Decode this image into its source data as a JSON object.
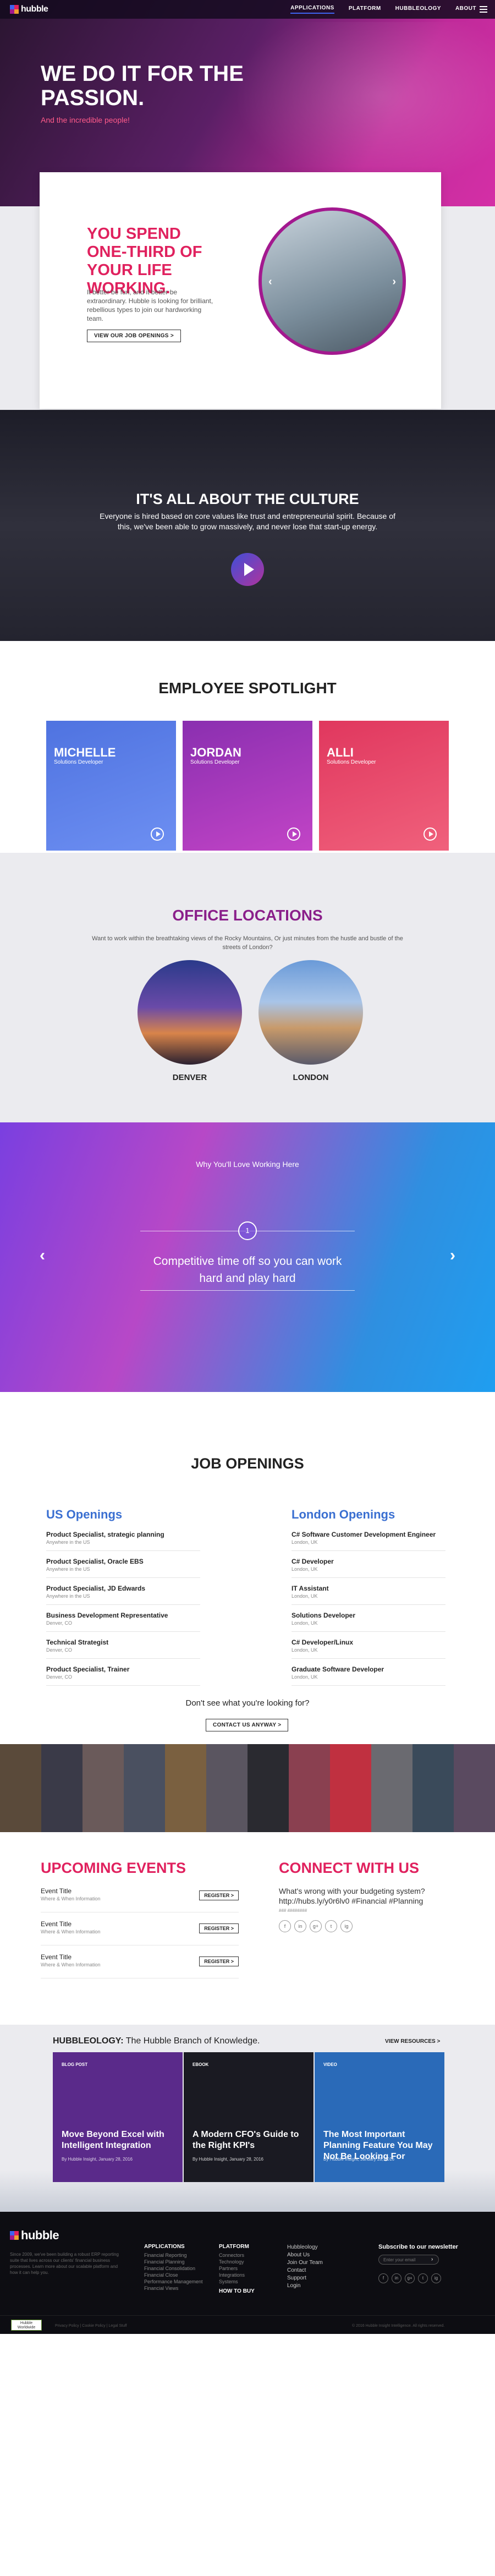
{
  "nav": {
    "logo": "hubble",
    "links": [
      "APPLICATIONS",
      "PLATFORM",
      "HUBBLEOLOGY",
      "ABOUT"
    ]
  },
  "hero": {
    "headline": "WE DO IT FOR THE PASSION.",
    "subline": "And the incredible people!"
  },
  "intro": {
    "headline": "YOU SPEND ONE-THIRD OF YOUR LIFE WORKING.",
    "body": "It better be fun, and it better be extraordinary. Hubble is looking for brilliant, rebellious types to join our hardworking team.",
    "button": "VIEW OUR JOB OPENINGS  >"
  },
  "culture": {
    "title": "IT'S ALL ABOUT THE CULTURE",
    "body": "Everyone is hired based on core values like trust and entrepreneurial spirit. Because of this, we've been able to grow massively, and never lose that start-up energy."
  },
  "spotlight": {
    "title": "EMPLOYEE SPOTLIGHT",
    "cards": [
      {
        "name": "MICHELLE",
        "role": "Solutions Developer",
        "color_top": "#4f73e0",
        "color_bottom": "#6d8ff2"
      },
      {
        "name": "JORDAN",
        "role": "Solutions Developer",
        "color_top": "#8a2fb0",
        "color_bottom": "#c244c6"
      },
      {
        "name": "ALLI",
        "role": "Solutions Developer",
        "color_top": "#e0375e",
        "color_bottom": "#f0617c"
      }
    ]
  },
  "offices": {
    "title": "OFFICE LOCATIONS",
    "body": "Want to work within the breathtaking views of the Rocky Mountains, Or just minutes from the hustle and bustle of the streets of London?",
    "locations": [
      "DENVER",
      "LONDON"
    ]
  },
  "why": {
    "heading": "Why You'll Love Working Here",
    "index": "1",
    "quote": "Competitive time off so you can work hard and play hard"
  },
  "jobs": {
    "title": "JOB OPENINGS",
    "us": {
      "heading": "US Openings",
      "items": [
        {
          "title": "Product Specialist, strategic planning",
          "loc": "Anywhere in the US"
        },
        {
          "title": "Product Specialist, Oracle EBS",
          "loc": "Anywhere in the US"
        },
        {
          "title": "Product Specialist, JD Edwards",
          "loc": "Anywhere in the US"
        },
        {
          "title": "Business Development Representative",
          "loc": "Denver, CO"
        },
        {
          "title": "Technical Strategist",
          "loc": "Denver, CO"
        },
        {
          "title": "Product Specialist, Trainer",
          "loc": "Denver, CO"
        }
      ]
    },
    "london": {
      "heading": "London Openings",
      "items": [
        {
          "title": "C# Software Customer Development Engineer",
          "loc": "London, UK"
        },
        {
          "title": "C# Developer",
          "loc": "London, UK"
        },
        {
          "title": "IT Assistant",
          "loc": "London, UK"
        },
        {
          "title": "Solutions Developer",
          "loc": "London, UK"
        },
        {
          "title": "C# Developer/Linux",
          "loc": "London, UK"
        },
        {
          "title": "Graduate Software Developer",
          "loc": "London, UK"
        }
      ]
    },
    "question": "Don't see what you're looking for?",
    "button": "CONTACT US ANYWAY  >"
  },
  "strip": {
    "colors": [
      "#5a4a3a",
      "#3a3a48",
      "#6a5a5a",
      "#4a5060",
      "#7a6040",
      "#5a5560",
      "#2a2a30",
      "#8a4050",
      "#c03040",
      "#6a6a70",
      "#3a4a5a",
      "#5a4a60"
    ]
  },
  "events": {
    "title": "UPCOMING EVENTS",
    "items": [
      {
        "title": "Event Title",
        "sub": "Where & When Information",
        "button": "REGISTER  >"
      },
      {
        "title": "Event Title",
        "sub": "Where & When Information",
        "button": "REGISTER  >"
      },
      {
        "title": "Event Title",
        "sub": "Where & When Information",
        "button": "REGISTER  >"
      }
    ]
  },
  "connect": {
    "title": "CONNECT WITH US",
    "tweet": "What's wrong with your budgeting system? http://hubs.ly/y0r6lv0 #Financial #Planning",
    "date": "### ########",
    "icons": [
      "f",
      "in",
      "g+",
      "t",
      "ig"
    ]
  },
  "resources": {
    "heading_bold": "HUBBLEOLOGY:",
    "heading_rest": " The Hubble Branch of Knowledge.",
    "view": "VIEW RESOURCES  >",
    "cards": [
      {
        "tag": "BLOG POST",
        "title": "Move Beyond Excel with Intelligent Integration",
        "meta": "By Hubble Insight, January 28, 2016",
        "bg": "#5a2a8a"
      },
      {
        "tag": "EBOOK",
        "title": "A Modern CFO's Guide to the Right KPI's",
        "meta": "By Hubble Insight, January 28, 2016",
        "bg": "#1a1a22"
      },
      {
        "tag": "VIDEO",
        "title": "The Most Important Planning Feature You May Not Be Looking For",
        "meta": "By Hubble Insight, January 28, 2016",
        "bg": "#2a6ab8"
      }
    ]
  },
  "footer": {
    "logo": "hubble",
    "about": "Since 2009, we've been building a robust ERP reporting suite that lives across our clients' financial business processes. Learn more about our scalable platform and how it can help you.",
    "col1": {
      "head": "APPLICATIONS",
      "items": [
        "Financial Reporting",
        "Financial Planning",
        "Financial Consolidation",
        "Financial Close",
        "Performance Management",
        "Financial Views"
      ]
    },
    "col2": {
      "head": "PLATFORM",
      "items": [
        "Connectors",
        "Technology",
        "Partners",
        "Integrations",
        "Systems"
      ],
      "extra": "HOW TO BUY"
    },
    "col3": {
      "items": [
        "Hubbleology",
        "About Us",
        "Join Our Team",
        "Contact",
        "Support",
        "Login"
      ]
    },
    "newsletter": "Subscribe to our newsletter",
    "email_placeholder": "Enter your email",
    "icons": [
      "f",
      "in",
      "g+",
      "t",
      "ig"
    ],
    "badge": "Hubble Worldwide",
    "legal": "Privacy Policy  |  Cookie Policy  |  Legal Stuff",
    "copy": "© 2016 Hubble Insight Intelligence. All rights reserved."
  }
}
